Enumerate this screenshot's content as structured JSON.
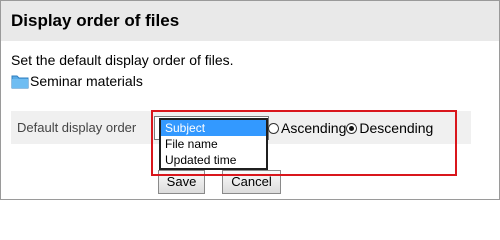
{
  "page": {
    "title": "Display order of files",
    "description": "Set the default display order of files.",
    "folder_name": "Seminar materials"
  },
  "setting": {
    "label": "Default display order",
    "select": {
      "options": [
        "Subject",
        "File name",
        "Updated time"
      ],
      "selected": "Subject"
    },
    "radio": {
      "options": [
        {
          "label": "Ascending",
          "checked": false
        },
        {
          "label": "Descending",
          "checked": true
        }
      ]
    }
  },
  "buttons": {
    "save": "Save",
    "cancel": "Cancel"
  },
  "colors": {
    "header_bg": "#e9e9e9",
    "setting_row_bg": "#f0f0f0",
    "selection": "#3399ff",
    "highlight": "#d9161c",
    "folder": "#5aabe6"
  },
  "icons": {
    "folder": "folder-icon"
  }
}
